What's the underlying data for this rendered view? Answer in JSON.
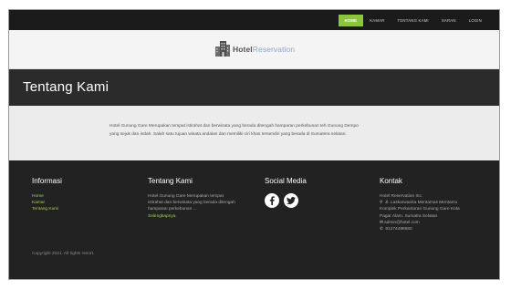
{
  "nav": {
    "items": [
      {
        "label": "HOME",
        "active": true
      },
      {
        "label": "KAMAR",
        "active": false
      },
      {
        "label": "TENTANG KAMI",
        "active": false
      },
      {
        "label": "SARAN",
        "active": false
      },
      {
        "label": "LOGIN",
        "active": false
      }
    ]
  },
  "logo": {
    "part1": "Hotel",
    "part2": "Reservation"
  },
  "page_title": "Tentang Kami",
  "content": {
    "line1": "Hotel Gunung Gare Merupakan tempat istirahat dan berwisata yang berada ditengah hamparan perkebunan teh Gunung Dempo",
    "line2": "yang sejuk dan indah. Salah satu tujuan wisata andalan dan memiliki ciri khas tersendiri yang berada di Sumatera selatan."
  },
  "footer": {
    "informasi": {
      "heading": "Informasi",
      "links": [
        "Home",
        "Kamar",
        "Tentang Kami"
      ]
    },
    "tentang": {
      "heading": "Tentang Kami",
      "lines": [
        "Hotel Gunung Gare Merupakan tempat",
        "istirahat dan berwisata yang berada ditengah",
        "hamparan perkebunan ..."
      ],
      "more": "Selengkapnya"
    },
    "social": {
      "heading": "Social Media",
      "icons": [
        "facebook-icon",
        "twitter-icon"
      ]
    },
    "kontak": {
      "heading": "Kontak",
      "name": "Hotel Reservation Inc.",
      "address1": "Jl. Laskarwanita Mentamas Mentamo",
      "address2": "Komplek Perkantoran Gunung Gare Kota",
      "address3": "Pagar Alam, Sumatra Selatan",
      "email": "admin@hotel.com",
      "phone": "81274498550"
    },
    "copyright": "Copyright 2021. All rights resort."
  },
  "colors": {
    "accent": "#8cc63f",
    "link": "#9fd24d",
    "dark": "#222222"
  }
}
